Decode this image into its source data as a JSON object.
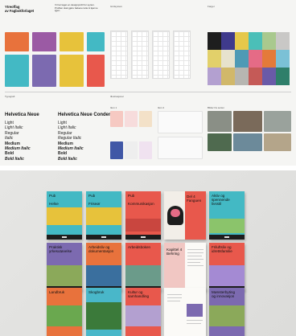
{
  "board": {
    "title": "Ytreoffag\nav Fagbokforlaget",
    "intro": "Vi har laget en designprofil for serien. Profilen skal gjøre bøkene lette å kjenne igjen.",
    "labels": {
      "typografi": "Typografi",
      "grid": "Gridsystem",
      "farger": "Farger",
      "illustrasjoner": "Illustrasjoner",
      "bilder": "Bilder",
      "ikon1": "Ikon 1",
      "ikon2": "Ikon 2",
      "foto": "Bilder fra serien"
    },
    "fonts": {
      "a_name": "Helvetica Neue",
      "b_name": "Helvetica Neue Condensed",
      "a_weights": [
        "Light",
        "Light Italic",
        "Regular",
        "Italic",
        "Medium",
        "Medium Italic",
        "Bold",
        "Bold Italic"
      ],
      "b_weights": [
        "Light",
        "Light Italic",
        "Regular",
        "Regular Italic",
        "Medium",
        "Medium Italic",
        "Bold",
        "Bold Italic"
      ]
    },
    "mini_covers": [
      "Yrkesfag",
      "Arbeidslivsfag",
      "Kurs"
    ],
    "palette": [
      "#1e1e1e",
      "#3f3a8c",
      "#e6c84a",
      "#4bbfb8",
      "#a9c98e",
      "#c9c8c6",
      "#e2d06a",
      "#e7e2cd",
      "#4f9ab5",
      "#e56b86",
      "#e47a3a",
      "#7bc1d6",
      "#b3a0d0",
      "#d1b86a",
      "#b7b6b1",
      "#c55a57",
      "#6a5aa8",
      "#2f7f6a"
    ]
  },
  "books": {
    "row1": [
      {
        "title": "Pub\n\nHelse",
        "top": "#43b9c4",
        "band": "#e7c23b",
        "bottom": "#2d9ea6"
      },
      {
        "title": "Pub\n\nFriseør",
        "top": "#43b9c4",
        "band": "#e7c23b",
        "bottom": "#2d9ea6"
      },
      {
        "title": "Pub\n\nKommunikasjon",
        "top": "#e8584c",
        "band": "#e8584c",
        "bottom": "#d94a41"
      }
    ],
    "row1_spread": "Del 4\nFanguen",
    "row1_last": "Aktiv og\nspennende\nlivsstil",
    "row2": [
      {
        "title": "Praktisk\nyrkesutøvelse",
        "top": "#7c6ab0",
        "band": "#a48ad3",
        "bottom": "#5e8a3a"
      },
      {
        "title": "Arbeidsliv og\ndokumentasjon",
        "top": "#e8723c",
        "band": "#e8723c",
        "bottom": "#3a6f9e"
      },
      {
        "title": "Arbeidsboken",
        "top": "#e8584c",
        "band": "#e8584c",
        "bottom": "#2d9ea6"
      }
    ],
    "row2_spread": "Kapittel 4\nBehring",
    "row2_last": "Friluftsliv og\nidrettsfamilie",
    "row3": [
      {
        "title": "Landbruk",
        "top": "#e8723c",
        "band": "#e8723c",
        "bottom": "#6aa84f"
      },
      {
        "title": "Skogbruk",
        "top": "#49b7c9",
        "band": "#49b7c9",
        "bottom": "#3b7a3a"
      },
      {
        "title": "Kultur og\nsamhandling",
        "top": "#e8584c",
        "band": "#e8584c",
        "bottom": "#b3a0d0"
      }
    ],
    "row3_last": "Mønsterbyting\nog innovasjon"
  }
}
